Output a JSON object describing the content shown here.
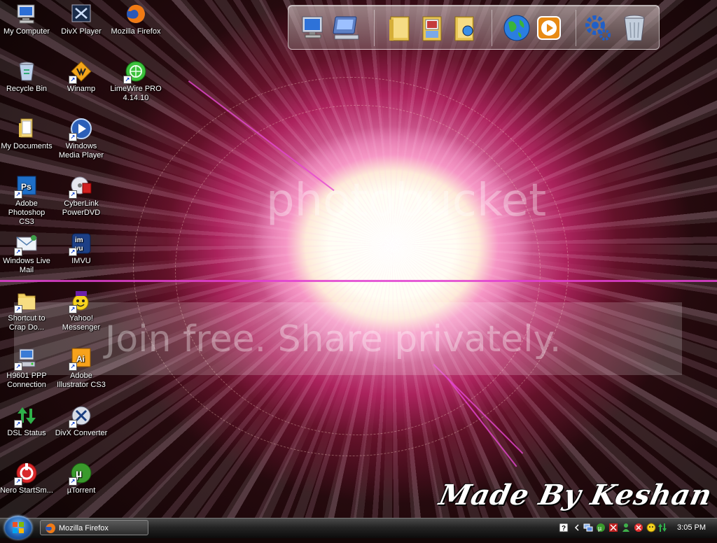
{
  "desktop": {
    "icons": [
      {
        "label": "My Computer"
      },
      {
        "label": "DivX Player"
      },
      {
        "label": "Mozilla Firefox"
      },
      {
        "label": "Recycle Bin"
      },
      {
        "label": "Winamp"
      },
      {
        "label": "LimeWire PRO 4.14.10"
      },
      {
        "label": "My Documents"
      },
      {
        "label": "Windows Media Player"
      },
      {
        "label": "Adobe Photoshop CS3"
      },
      {
        "label": "CyberLink PowerDVD"
      },
      {
        "label": "Windows Live Mail"
      },
      {
        "label": "IMVU"
      },
      {
        "label": "Shortcut to Crap Do..."
      },
      {
        "label": "Yahoo! Messenger"
      },
      {
        "label": "H9601 PPP Connection"
      },
      {
        "label": "Adobe Illustrator CS3"
      },
      {
        "label": "DSL Status"
      },
      {
        "label": "DivX Converter"
      },
      {
        "label": "Nero StartSm..."
      },
      {
        "label": "µTorrent"
      }
    ]
  },
  "dock": {
    "items": [
      "monitor-icon",
      "network-drive-icon",
      "folder-icon",
      "pictures-folder-icon",
      "folder-link-icon",
      "globe-icon",
      "media-player-icon",
      "gear-icon",
      "trash-can-icon"
    ]
  },
  "wallpaper": {
    "watermark_brand": "photobucket",
    "watermark_tagline": "Join free. Share privately.",
    "signature": "Made By Keshan",
    "colors": {
      "core": "#ffffff",
      "ring": "#e0408a",
      "line": "#e040d0",
      "background": "#120606"
    }
  },
  "taskbar": {
    "start_icon": "windows-orb-icon",
    "tasks": [
      {
        "label": "Mozilla Firefox",
        "icon": "firefox-icon"
      }
    ],
    "tray_icons": [
      "help-icon",
      "chevron-left-icon",
      "network-icon",
      "utorrent-tray-icon",
      "antivirus-icon",
      "messenger-icon",
      "error-icon",
      "yahoo-tray-icon",
      "updown-arrows-icon"
    ],
    "clock": "3:05 PM"
  }
}
